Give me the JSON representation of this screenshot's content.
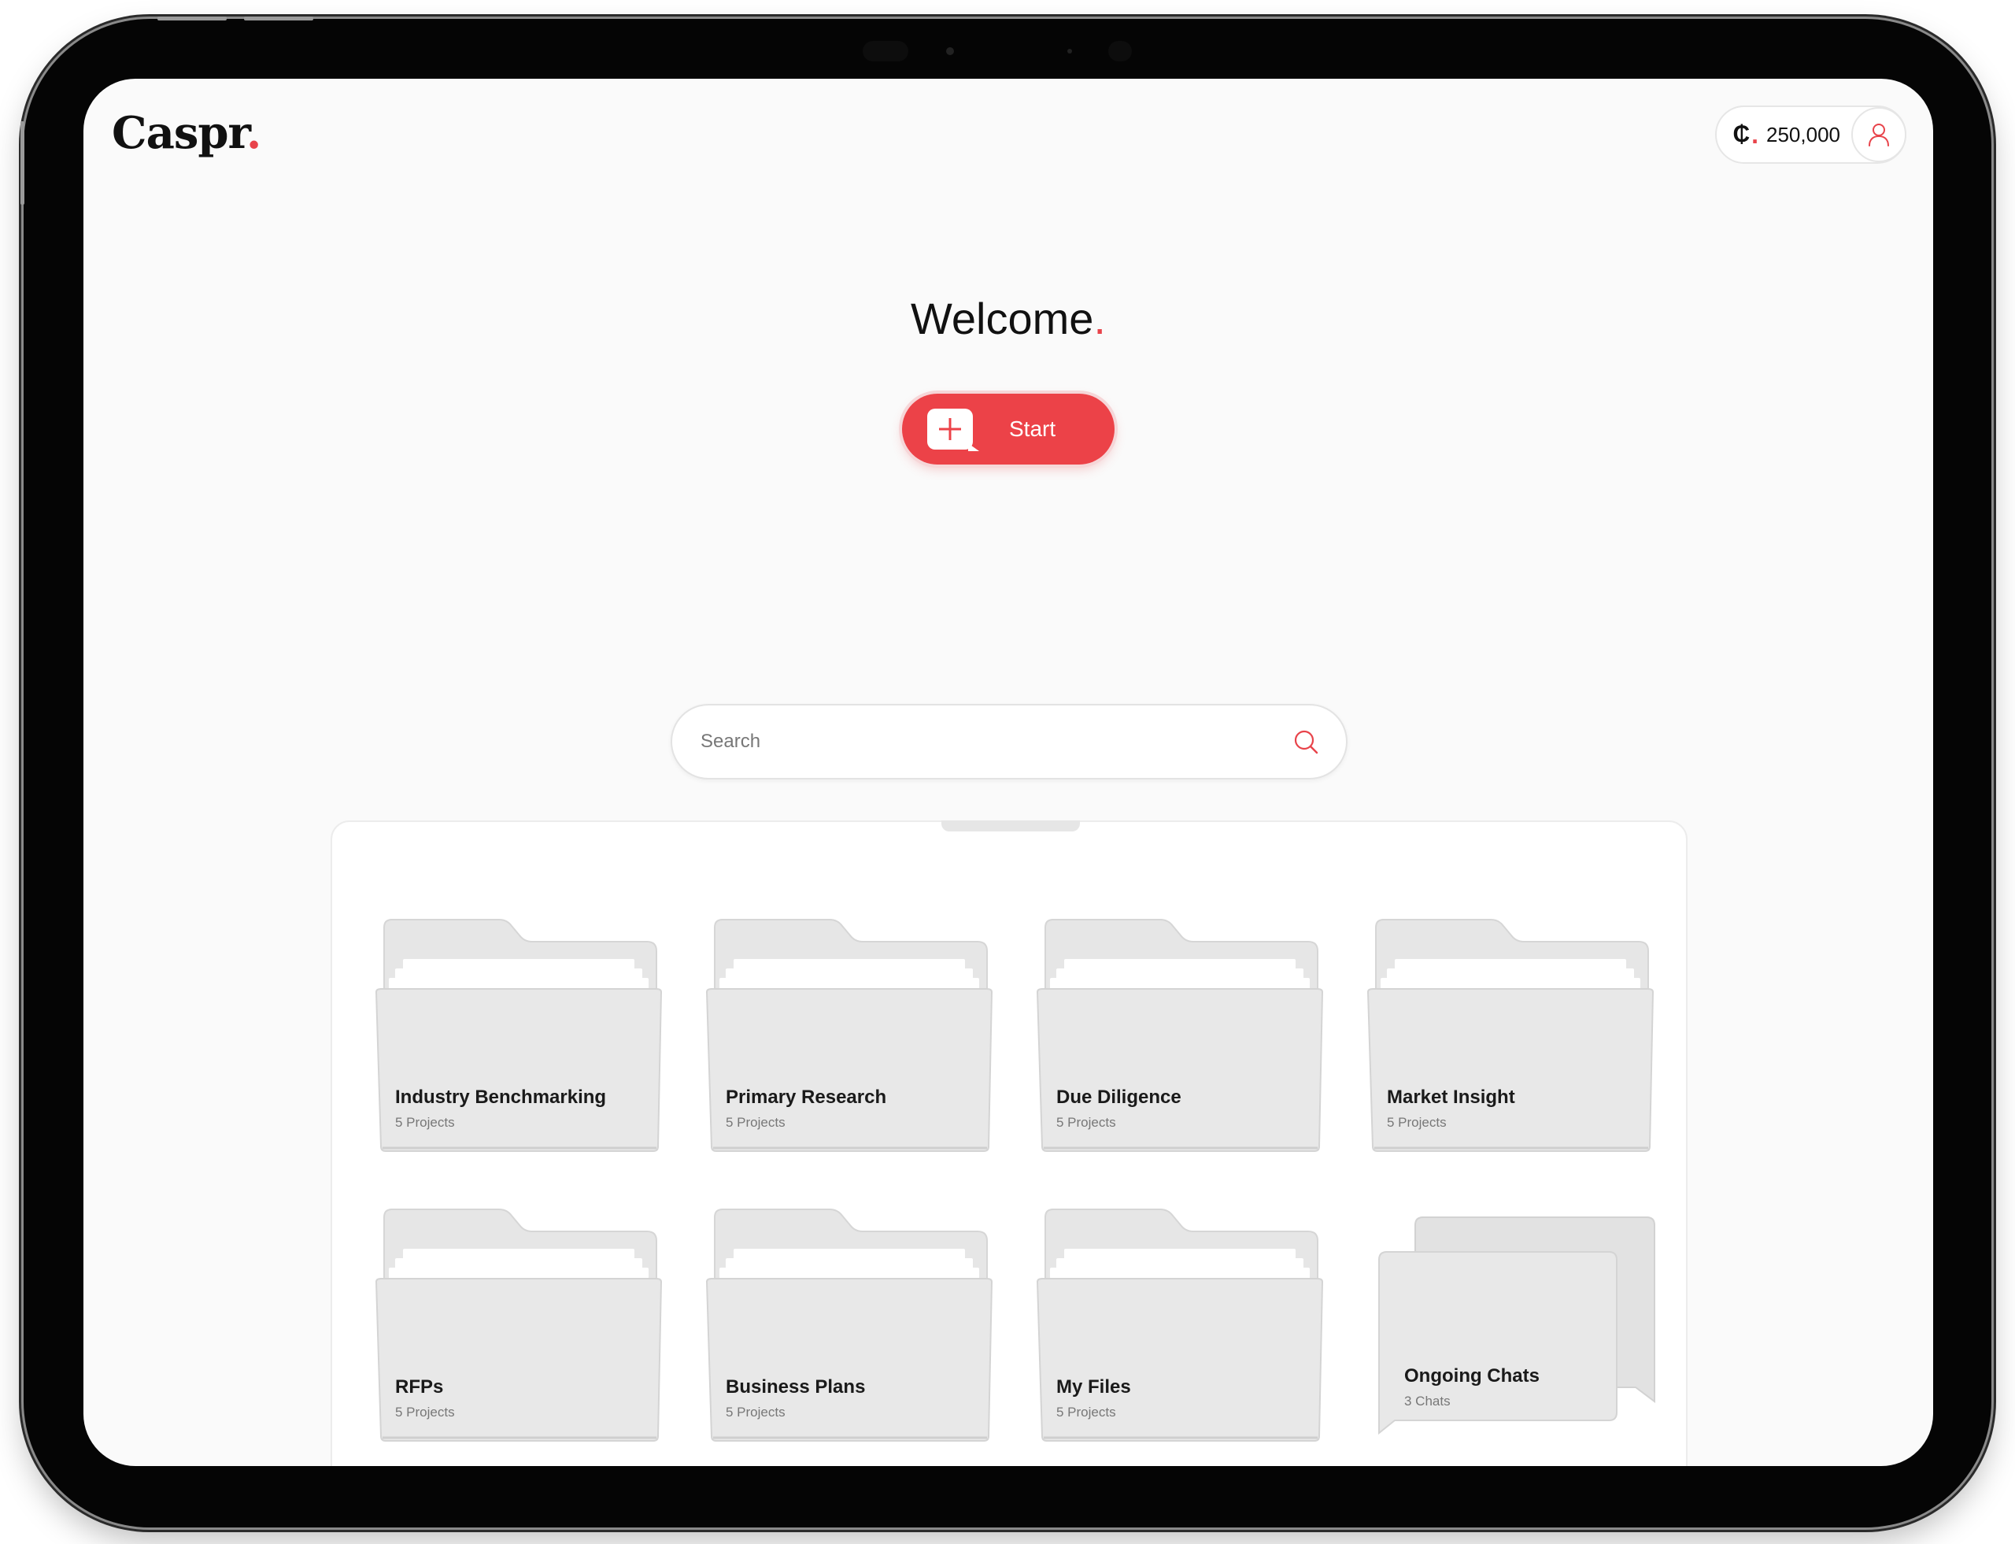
{
  "brand": {
    "name": "Caspr",
    "dot": "."
  },
  "credits": {
    "symbol": "₵",
    "dot": ".",
    "amount": "250,000"
  },
  "hero": {
    "title": "Welcome",
    "title_dot": ".",
    "start_label": "Start"
  },
  "search": {
    "placeholder": "Search"
  },
  "folders": [
    {
      "name": "Industry Benchmarking",
      "count": "5 Projects"
    },
    {
      "name": "Primary Research",
      "count": "5 Projects"
    },
    {
      "name": "Due Diligence",
      "count": "5 Projects"
    },
    {
      "name": "Market Insight",
      "count": "5 Projects"
    },
    {
      "name": "RFPs",
      "count": "5 Projects"
    },
    {
      "name": "Business Plans",
      "count": "5 Projects"
    },
    {
      "name": "My Files",
      "count": "5 Projects"
    }
  ],
  "chats": {
    "name": "Ongoing Chats",
    "count": "3 Chats"
  },
  "colors": {
    "accent": "#ec4248",
    "folder": "#e8e8e8",
    "background": "#fafafa"
  },
  "icons": {
    "start": "plus-chat-icon",
    "search": "search-icon",
    "user": "user-icon",
    "folder": "folder-icon",
    "chats": "chat-bubbles-icon"
  }
}
